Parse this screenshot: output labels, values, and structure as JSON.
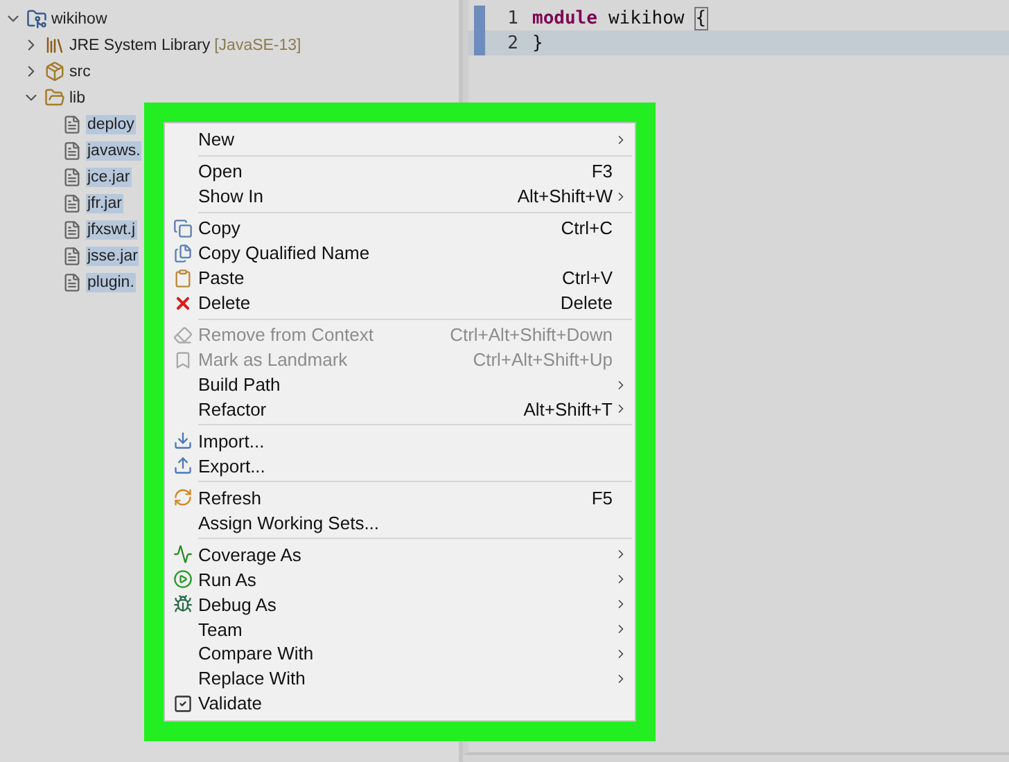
{
  "explorer": {
    "items": [
      {
        "label": "wikihow",
        "kind": "project",
        "expanded": true,
        "children": [
          {
            "label": "JRE System Library",
            "decoration": "[JavaSE-13]",
            "kind": "library",
            "expanded": false
          },
          {
            "label": "src",
            "kind": "package",
            "expanded": false
          },
          {
            "label": "lib",
            "kind": "folder",
            "expanded": true,
            "children": [
              {
                "label": "deploy",
                "kind": "file",
                "selected": true
              },
              {
                "label": "javaws.",
                "kind": "file",
                "selected": true
              },
              {
                "label": "jce.jar",
                "kind": "file",
                "selected": true
              },
              {
                "label": "jfr.jar",
                "kind": "file",
                "selected": true
              },
              {
                "label": "jfxswt.j",
                "kind": "file",
                "selected": true
              },
              {
                "label": "jsse.jar",
                "kind": "file",
                "selected": true
              },
              {
                "label": "plugin.",
                "kind": "file",
                "selected": true
              }
            ]
          }
        ]
      }
    ]
  },
  "editor": {
    "lines": [
      {
        "number": "1",
        "current": false,
        "tokens": [
          {
            "text": "module",
            "kind": "keyword"
          },
          {
            "text": "wikihow",
            "kind": "plain"
          },
          {
            "text": "{",
            "kind": "bracket"
          }
        ]
      },
      {
        "number": "2",
        "current": true,
        "tokens": [
          {
            "text": "}",
            "kind": "plain"
          }
        ]
      }
    ]
  },
  "context_menu": {
    "items": [
      {
        "kind": "plain",
        "label": "New",
        "submenu": true,
        "disabled": false
      },
      {
        "kind": "separator"
      },
      {
        "kind": "plain",
        "label": "Open",
        "shortcut": "F3",
        "submenu": false,
        "disabled": false
      },
      {
        "kind": "plain",
        "label": "Show In",
        "shortcut": "Alt+Shift+W",
        "submenu": true,
        "disabled": false
      },
      {
        "kind": "separator"
      },
      {
        "kind": "copy",
        "label": "Copy",
        "shortcut": "Ctrl+C",
        "submenu": false,
        "disabled": false
      },
      {
        "kind": "names",
        "label": "Copy Qualified Name",
        "submenu": false,
        "disabled": false
      },
      {
        "kind": "paste",
        "label": "Paste",
        "shortcut": "Ctrl+V",
        "submenu": false,
        "disabled": false
      },
      {
        "kind": "delete",
        "label": "Delete",
        "shortcut": "Delete",
        "submenu": false,
        "disabled": false
      },
      {
        "kind": "separator"
      },
      {
        "kind": "eraser",
        "label": "Remove from Context",
        "shortcut": "Ctrl+Alt+Shift+Down",
        "submenu": false,
        "disabled": true
      },
      {
        "kind": "bookmark",
        "label": "Mark as Landmark",
        "shortcut": "Ctrl+Alt+Shift+Up",
        "submenu": false,
        "disabled": true
      },
      {
        "kind": "plain",
        "label": "Build Path",
        "submenu": true,
        "disabled": false
      },
      {
        "kind": "plain",
        "label": "Refactor",
        "shortcut": "Alt+Shift+T",
        "submenu": true,
        "disabled": false
      },
      {
        "kind": "separator"
      },
      {
        "kind": "import",
        "label": "Import...",
        "submenu": false,
        "disabled": false
      },
      {
        "kind": "export",
        "label": "Export...",
        "submenu": false,
        "disabled": false
      },
      {
        "kind": "separator"
      },
      {
        "kind": "refresh",
        "label": "Refresh",
        "shortcut": "F5",
        "submenu": false,
        "disabled": false
      },
      {
        "kind": "plain",
        "label": "Assign Working Sets...",
        "submenu": false,
        "disabled": false
      },
      {
        "kind": "separator"
      },
      {
        "kind": "coverage",
        "label": "Coverage As",
        "submenu": true,
        "disabled": false
      },
      {
        "kind": "run",
        "label": "Run As",
        "submenu": true,
        "disabled": false
      },
      {
        "kind": "debug",
        "label": "Debug As",
        "submenu": true,
        "disabled": false
      },
      {
        "kind": "plain",
        "label": "Team",
        "submenu": true,
        "disabled": false
      },
      {
        "kind": "plain",
        "label": "Compare With",
        "submenu": true,
        "disabled": false
      },
      {
        "kind": "plain",
        "label": "Replace With",
        "submenu": true,
        "disabled": false
      },
      {
        "kind": "validate",
        "label": "Validate",
        "submenu": false,
        "disabled": false
      }
    ]
  }
}
